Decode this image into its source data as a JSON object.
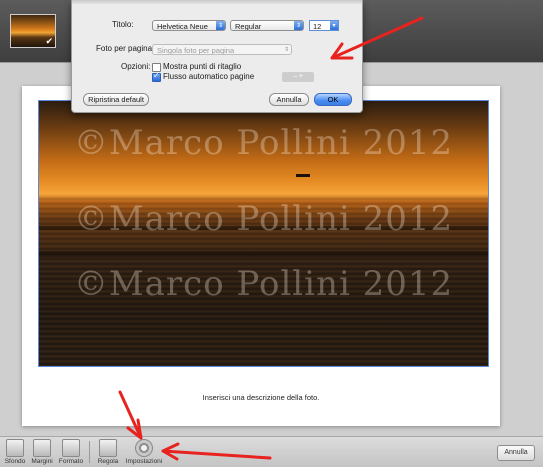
{
  "sheet": {
    "titolo_label": "Titolo:",
    "font_family": "Helvetica Neue",
    "font_style": "Regular",
    "font_size": "12",
    "foto_per_pagina_label": "Foto per pagina:",
    "foto_per_pagina_value": "Singola foto per pagina",
    "opzioni_label": "Opzioni:",
    "option_mostra_punti": "Mostra punti di ritaglio",
    "option_mostra_punti_checked": false,
    "option_flusso": "Flusso automatico pagine",
    "option_flusso_checked": true,
    "ripristina_label": "Ripristina default",
    "annulla_label": "Annulla",
    "ok_label": "OK"
  },
  "photo": {
    "watermark": "©Marco Pollini 2012",
    "caption": "Inserisci una descrizione della foto."
  },
  "toolbar": {
    "sfondo": "Sfondo",
    "margini": "Margini",
    "formato": "Formato",
    "regola": "Regola",
    "impostazioni": "Impostazioni",
    "annulla": "Annulla"
  },
  "colors": {
    "annotation_arrow": "#e8231f",
    "accent_blue": "#2d6fd8"
  }
}
